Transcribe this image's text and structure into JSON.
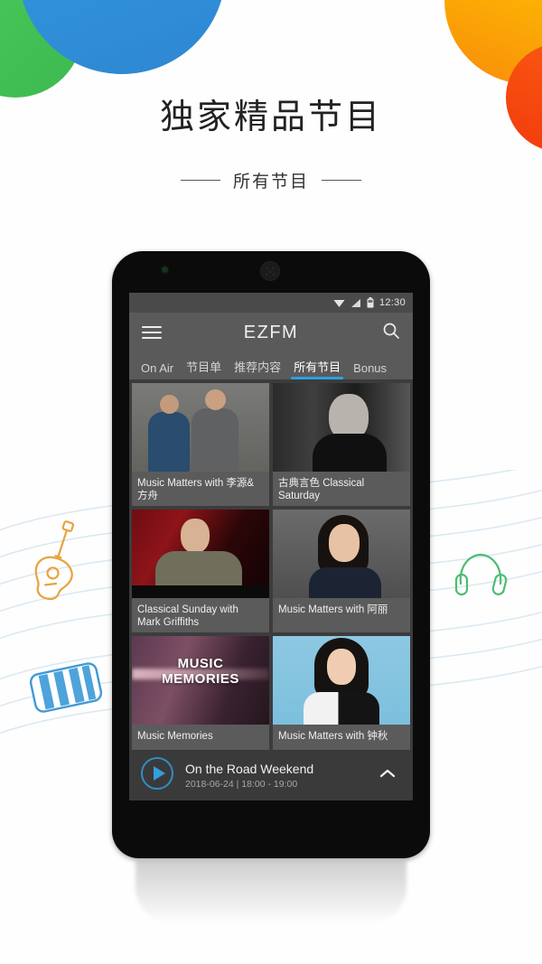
{
  "hero": {
    "title": "独家精品节目",
    "subtitle": "所有节目"
  },
  "colors": {
    "accent_blue": "#2f9fe0",
    "circle_green": "#4cc85b",
    "circle_blue": "#2f9ce0",
    "circle_orange": "#f9a00a",
    "circle_red": "#f4450f",
    "doodle_guitar": "#e8a33d",
    "doodle_piano": "#3f9ad6",
    "doodle_headphones": "#4dbd72"
  },
  "decor": {
    "guitar_icon": "guitar-icon",
    "piano_icon": "piano-keys-icon",
    "headphones_icon": "headphones-icon"
  },
  "phone": {
    "statusbar": {
      "time": "12:30",
      "wifi_icon": "wifi-icon",
      "signal_icon": "signal-icon",
      "battery_icon": "battery-icon"
    },
    "appbar": {
      "menu_icon": "hamburger-menu-icon",
      "title": "EZFM",
      "search_icon": "search-icon"
    },
    "tabs": [
      {
        "label": "On Air",
        "active": false
      },
      {
        "label": "节目单",
        "active": false
      },
      {
        "label": "推荐内容",
        "active": false
      },
      {
        "label": "所有节目",
        "active": true
      },
      {
        "label": "Bonus",
        "active": false
      }
    ],
    "programs": [
      {
        "title": "Music Matters with 李源&方舟"
      },
      {
        "title": "古典言色 Classical Saturday"
      },
      {
        "title": "Classical Sunday with Mark Griffiths"
      },
      {
        "title": "Music Matters with 阿丽"
      },
      {
        "title": "Music Memories",
        "thumb_text": "MUSIC\nMEMORIES"
      },
      {
        "title": "Music Matters with 钟秋"
      }
    ],
    "player": {
      "play_icon": "play-icon",
      "title": "On the Road Weekend",
      "schedule": "2018-06-24 | 18:00 - 19:00",
      "expand_icon": "chevron-up-icon"
    }
  }
}
